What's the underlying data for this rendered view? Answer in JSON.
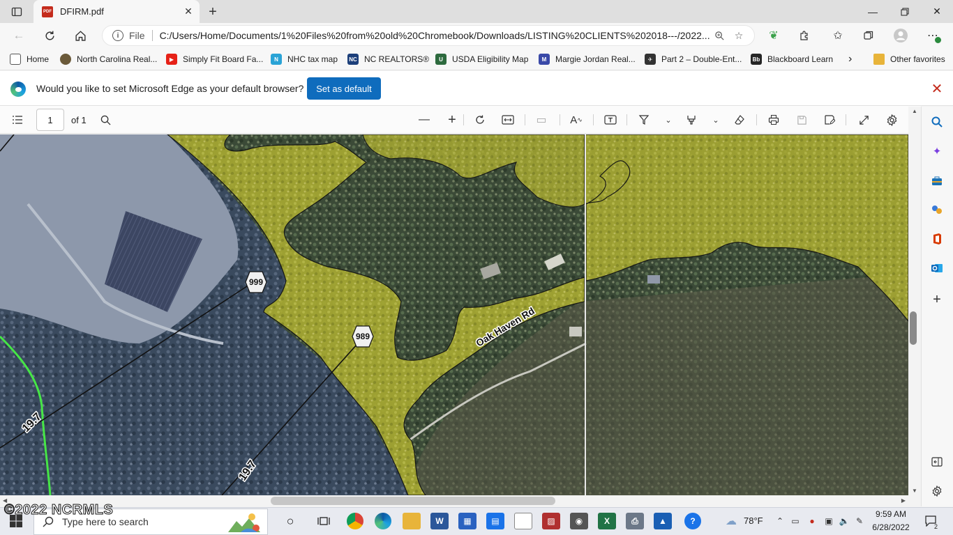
{
  "browser": {
    "tab_title": "DFIRM.pdf",
    "tab_favicon_text": "PDF",
    "scheme": "File",
    "url": "C:/Users/Home/Documents/1%20Files%20from%20old%20Chromebook/Downloads/LISTING%20CLIENTS%202018---/2022..."
  },
  "bookmarks": [
    {
      "label": "Home",
      "icon": "page-icon",
      "color": "#ffffff"
    },
    {
      "label": "North Carolina Real...",
      "icon": "nc-real-estate-icon",
      "color": "#6b5a3a"
    },
    {
      "label": "Simply Fit Board Fa...",
      "icon": "youtube-icon",
      "color": "#e62117"
    },
    {
      "label": "NHC tax map",
      "icon": "nhc-map-icon",
      "color": "#2aa3d6"
    },
    {
      "label": "NC REALTORS®",
      "icon": "nc-realtors-icon",
      "color": "#1c3f7a"
    },
    {
      "label": "USDA Eligibility Map",
      "icon": "usda-icon",
      "color": "#2d6a3e"
    },
    {
      "label": "Margie Jordan Real...",
      "icon": "realtor-icon",
      "color": "#3a49a8"
    },
    {
      "label": "Part 2 – Double-Ent...",
      "icon": "accounting-icon",
      "color": "#333333"
    },
    {
      "label": "Blackboard Learn",
      "icon": "blackboard-icon",
      "color": "#262626"
    }
  ],
  "bookmarks_more": "Other favorites",
  "infobar": {
    "message": "Would you like to set Microsoft Edge as your default browser?",
    "button": "Set as default"
  },
  "pdf": {
    "page_current": "1",
    "page_total": "of 1"
  },
  "map": {
    "road_label": "Oak Haven Rd",
    "shield_1": "999",
    "shield_2": "989",
    "elevation_1": "19.7",
    "elevation_2": "19.7",
    "watermark": "©2022 NCRMLS",
    "colors": {
      "flood_zone": "#c8c832",
      "water_boundary": "#46e646"
    }
  },
  "taskbar": {
    "search_placeholder": "Type here to search",
    "weather": "78°F",
    "time": "9:59 AM",
    "date": "6/28/2022",
    "notification_badge": "2"
  }
}
